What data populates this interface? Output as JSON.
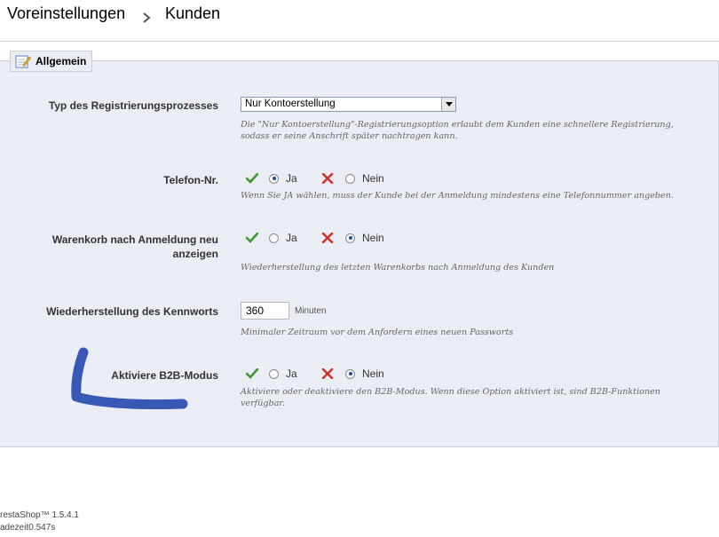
{
  "breadcrumb": {
    "parent": "Voreinstellungen",
    "separator": "›",
    "current": "Kunden"
  },
  "fieldset": {
    "legend": "Allgemein",
    "legend_icon": "edit-note-icon"
  },
  "settings": {
    "registration": {
      "label": "Typ des Registrierungsprozesses",
      "selected": "Nur Kontoerstellung",
      "description_1": "Die \"Nur Kontoerstellung\"-Registrierungsoption erlaubt dem Kunden eine schnellere Registrierung,",
      "description_2": "sodass er seine Anschrift später nachtragen kann."
    },
    "phone": {
      "label": "Telefon-Nr.",
      "yes": "Ja",
      "no": "Nein",
      "selected": "yes",
      "description": "Wenn Sie JA wählen, muss der Kunde bei der Anmeldung mindestens eine Telefonnummer angeben."
    },
    "cart": {
      "label_1": "Warenkorb nach Anmeldung neu",
      "label_2": "anzeigen",
      "yes": "Ja",
      "no": "Nein",
      "selected": "no",
      "description": "Wiederherstellung des letzten Warenkorbs nach Anmeldung des Kunden"
    },
    "password": {
      "label": "Wiederherstellung des Kennworts",
      "value": "360",
      "unit": "Minuten",
      "description": "Minimaler Zeitraum vor dem Anfordern eines neuen Passworts"
    },
    "b2b": {
      "label": "Aktiviere B2B-Modus",
      "yes": "Ja",
      "no": "Nein",
      "selected": "no",
      "description_1": "Aktiviere oder deaktiviere den B2B-Modus. Wenn diese Option aktiviert ist, sind B2B-Funktionen",
      "description_2": "verfügbar."
    }
  },
  "footer": {
    "version": "restaShop™ 1.5.4.1",
    "load_time": "adezeit0.547s"
  },
  "colors": {
    "panel_bg": "#ebedf4",
    "check_green": "#3c9a2f",
    "cross_red": "#d0322a",
    "marker_blue": "#2f4fb0"
  }
}
